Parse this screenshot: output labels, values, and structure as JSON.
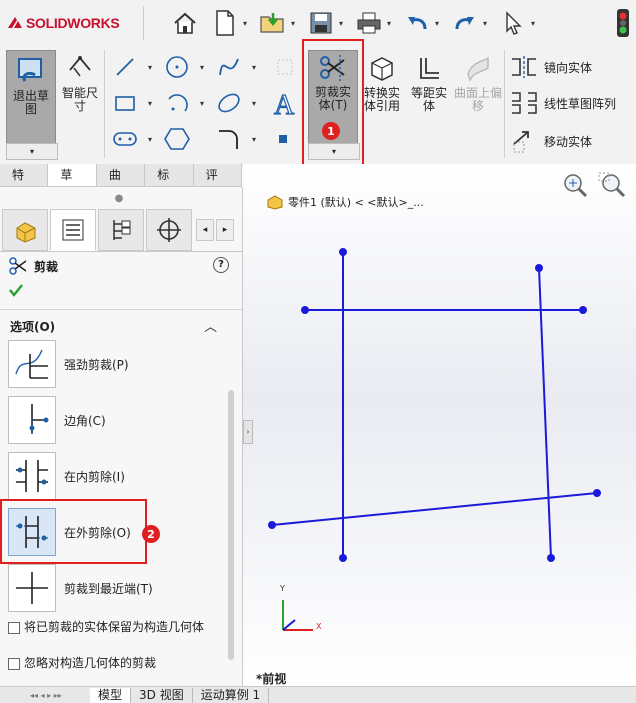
{
  "app": {
    "logo_text": "SOLIDWORKS"
  },
  "ribbon": {
    "exit_sketch": "退出草图",
    "smart_dim": "智能尺寸",
    "trim_entities": "剪裁实体(T)",
    "convert_entities": "转换实体引用",
    "offset_entities": "等距实体",
    "surface_offset": "曲面上偏移",
    "mirror_entities": "镜向实体",
    "linear_pattern": "线性草图阵列",
    "move_entities": "移动实体"
  },
  "tabs": [
    "特征",
    "草图",
    "曲面",
    "标注",
    "评估"
  ],
  "panel": {
    "title": "剪裁",
    "section": "选项(O)",
    "options": [
      {
        "label": "强劲剪裁(P)"
      },
      {
        "label": "边角(C)"
      },
      {
        "label": "在内剪除(I)"
      },
      {
        "label": "在外剪除(O)"
      },
      {
        "label": "剪裁到最近端(T)"
      }
    ],
    "check1": "将已剪裁的实体保留为构造几何体",
    "check2": "忽略对构造几何体的剪裁"
  },
  "viewport": {
    "breadcrumb": "零件1 (默认) < <默认>_...",
    "view_label": "*前视",
    "axis_y": "Y",
    "axis_x": "X"
  },
  "bottom_tabs": [
    "模型",
    "3D 视图",
    "运动算例 1"
  ],
  "badges": {
    "one": "1",
    "two": "2"
  },
  "colors": {
    "accent_red": "#e02020",
    "sketch_blue": "#1a1adb",
    "brand_red": "#c8102e"
  }
}
